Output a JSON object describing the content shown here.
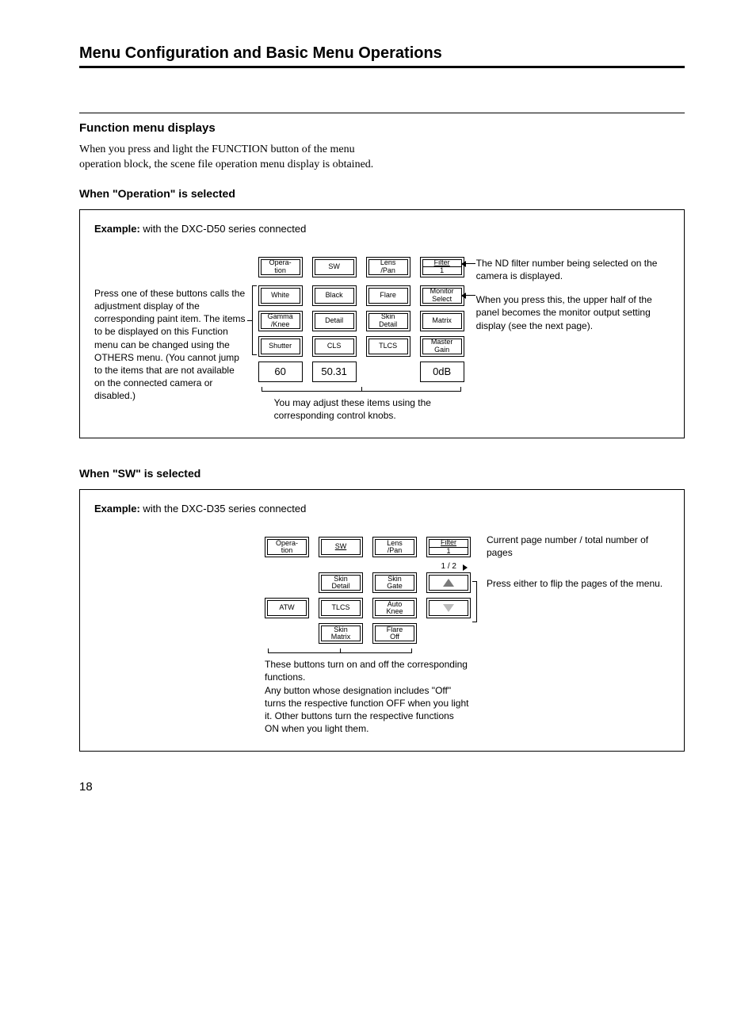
{
  "title": "Menu Configuration and Basic Menu Operations",
  "section": {
    "heading": "Function menu displays",
    "body": "When you press and light the FUNCTION button of the menu operation block, the scene file operation menu display is obtained."
  },
  "op": {
    "heading": "When \"Operation\" is selected",
    "example_label": "Example:",
    "example_text": " with the DXC-D50 series connected",
    "left_note": "Press one of these buttons calls the adjustment display of the corresponding paint item. The items to be displayed on this Function menu can be changed using the OTHERS menu.  (You cannot jump to the items that are not available on the connected camera or disabled.)",
    "right_note_1": "The ND filter number being selected on the camera is displayed.",
    "right_note_2": "When you press this, the upper half of the panel becomes the monitor output setting display (see the next page).",
    "knob_caption": "You may adjust these items using the corresponding control knobs.",
    "row1": {
      "a": "Opera-\ntion",
      "b": "SW",
      "c": "Lens\n/Pan",
      "d_top": "Filter",
      "d_bot": "1"
    },
    "row2": {
      "a": "White",
      "b": "Black",
      "c": "Flare",
      "d": "Monitor\nSelect"
    },
    "row3": {
      "a": "Gamma\n/Knee",
      "b": "Detail",
      "c": "Skin\nDetail",
      "d": "Matrix"
    },
    "row4": {
      "a": "Shutter",
      "b": "CLS",
      "c": "TLCS",
      "d": "Master\nGain"
    },
    "row5": {
      "a": "60",
      "b": "50.31",
      "d": "0dB"
    }
  },
  "sw": {
    "heading": "When \"SW\" is selected",
    "example_label": "Example:",
    "example_text": " with the DXC-D35 series connected",
    "right_note_1": "Current page number / total number of pages",
    "right_note_2": "Press either to flip the pages of the menu.",
    "bottom_note": "These buttons turn on and off the corresponding functions.\nAny button whose designation includes \"Off\" turns the respective function OFF when you light it.  Other buttons turn the respective functions ON when you light them.",
    "row1": {
      "a": "Opera-\ntion",
      "b": "SW",
      "c": "Lens\n/Pan",
      "d_top": "Filter",
      "d_bot": "1"
    },
    "page_indicator": "1 / 2",
    "row2": {
      "b": "Skin\nDetail",
      "c": "Skin\nGate"
    },
    "row3": {
      "a": "ATW",
      "b": "TLCS",
      "c": "Auto\nKnee"
    },
    "row4": {
      "b": "Skin\nMatrix",
      "c": "Flare\nOff"
    }
  },
  "page_number": "18"
}
